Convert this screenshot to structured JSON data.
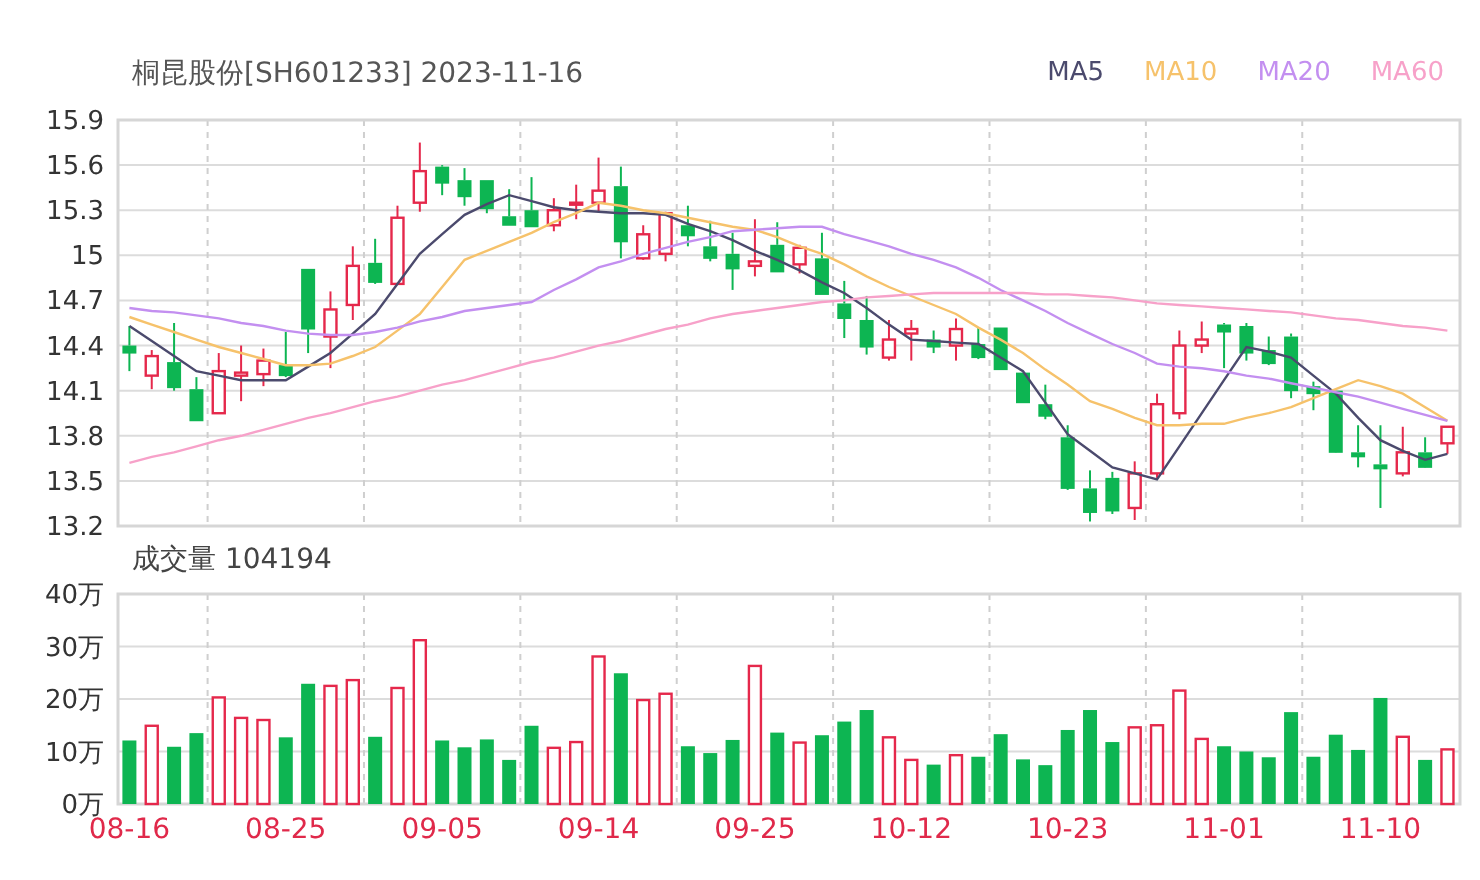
{
  "title": "桐昆股份[SH601233] 2023-11-16",
  "price_chart": {
    "chart_data": {
      "type": "candlestick",
      "grid": true,
      "ylim": [
        13.2,
        15.9
      ],
      "yticks": [
        13.2,
        13.5,
        13.8,
        14.1,
        14.4,
        14.7,
        15,
        15.3,
        15.6,
        15.9
      ],
      "ohlc": [
        [
          14.4,
          14.53,
          14.23,
          14.36
        ],
        [
          14.2,
          14.37,
          14.11,
          14.33
        ],
        [
          14.29,
          14.55,
          14.1,
          14.13
        ],
        [
          14.11,
          14.19,
          13.9,
          13.91
        ],
        [
          13.95,
          14.35,
          13.95,
          14.23
        ],
        [
          14.2,
          14.4,
          14.03,
          14.22
        ],
        [
          14.21,
          14.38,
          14.13,
          14.3
        ],
        [
          14.27,
          14.49,
          14.19,
          14.21
        ],
        [
          14.91,
          14.91,
          14.35,
          14.52
        ],
        [
          14.46,
          14.76,
          14.25,
          14.64
        ],
        [
          14.67,
          15.06,
          14.57,
          14.93
        ],
        [
          14.95,
          15.11,
          14.81,
          14.83
        ],
        [
          14.81,
          15.33,
          14.81,
          15.25
        ],
        [
          15.35,
          15.75,
          15.29,
          15.56
        ],
        [
          15.59,
          15.6,
          15.4,
          15.49
        ],
        [
          15.5,
          15.58,
          15.33,
          15.4
        ],
        [
          15.5,
          15.5,
          15.28,
          15.32
        ],
        [
          15.26,
          15.44,
          15.21,
          15.21
        ],
        [
          15.3,
          15.52,
          15.2,
          15.2
        ],
        [
          15.2,
          15.38,
          15.16,
          15.3
        ],
        [
          15.34,
          15.47,
          15.24,
          15.35
        ],
        [
          15.35,
          15.65,
          15.29,
          15.43
        ],
        [
          15.46,
          15.59,
          14.98,
          15.1
        ],
        [
          14.98,
          15.2,
          14.97,
          15.14
        ],
        [
          15.01,
          15.29,
          14.96,
          15.28
        ],
        [
          15.2,
          15.33,
          15.06,
          15.14
        ],
        [
          15.06,
          15.23,
          14.96,
          14.99
        ],
        [
          15.01,
          15.15,
          14.77,
          14.92
        ],
        [
          14.93,
          15.24,
          14.86,
          14.96
        ],
        [
          15.07,
          15.22,
          14.89,
          14.9
        ],
        [
          14.94,
          15.07,
          14.88,
          15.05
        ],
        [
          14.98,
          15.15,
          14.75,
          14.75
        ],
        [
          14.68,
          14.83,
          14.45,
          14.59
        ],
        [
          14.57,
          14.73,
          14.34,
          14.4
        ],
        [
          14.32,
          14.57,
          14.3,
          14.44
        ],
        [
          14.48,
          14.57,
          14.3,
          14.51
        ],
        [
          14.44,
          14.5,
          14.35,
          14.4
        ],
        [
          14.4,
          14.58,
          14.3,
          14.51
        ],
        [
          14.41,
          14.52,
          14.31,
          14.33
        ],
        [
          14.52,
          14.52,
          14.24,
          14.25
        ],
        [
          14.22,
          14.22,
          14.02,
          14.03
        ],
        [
          14.01,
          14.14,
          13.91,
          13.94
        ],
        [
          13.79,
          13.87,
          13.44,
          13.46
        ],
        [
          13.45,
          13.57,
          13.23,
          13.3
        ],
        [
          13.52,
          13.56,
          13.28,
          13.31
        ],
        [
          13.32,
          13.63,
          13.24,
          13.55
        ],
        [
          13.55,
          14.08,
          13.52,
          14.01
        ],
        [
          13.95,
          14.5,
          13.91,
          14.4
        ],
        [
          14.4,
          14.56,
          14.35,
          14.44
        ],
        [
          14.54,
          14.55,
          14.25,
          14.5
        ],
        [
          14.53,
          14.55,
          14.3,
          14.36
        ],
        [
          14.37,
          14.46,
          14.27,
          14.29
        ],
        [
          14.46,
          14.48,
          14.05,
          14.11
        ],
        [
          14.13,
          14.16,
          13.97,
          14.09
        ],
        [
          14.1,
          14.1,
          13.69,
          13.7
        ],
        [
          13.69,
          13.87,
          13.59,
          13.67
        ],
        [
          13.61,
          13.87,
          13.32,
          13.59
        ],
        [
          13.55,
          13.86,
          13.53,
          13.69
        ],
        [
          13.69,
          13.79,
          13.59,
          13.6
        ],
        [
          13.75,
          13.86,
          13.68,
          13.86
        ]
      ]
    }
  },
  "ma_chart": {
    "chart_data": {
      "type": "line",
      "ylim": [
        13.2,
        15.9
      ],
      "series": [
        {
          "name": "MA5",
          "color": "#4b4a6d",
          "values": [
            14.53,
            14.43,
            14.33,
            14.23,
            14.2,
            14.17,
            14.17,
            14.17,
            14.26,
            14.35,
            14.48,
            14.61,
            14.81,
            15.01,
            15.14,
            15.27,
            15.34,
            15.4,
            15.36,
            15.32,
            15.3,
            15.29,
            15.28,
            15.28,
            15.27,
            15.21,
            15.16,
            15.1,
            15.03,
            14.97,
            14.9,
            14.82,
            14.75,
            14.65,
            14.54,
            14.44,
            14.43,
            14.42,
            14.41,
            14.32,
            14.23,
            14.02,
            13.81,
            13.7,
            13.59,
            13.55,
            13.51,
            13.73,
            13.95,
            14.17,
            14.39,
            14.36,
            14.32,
            14.2,
            14.08,
            13.92,
            13.77,
            13.7,
            13.64,
            13.68
          ]
        },
        {
          "name": "MA10",
          "color": "#f6c26b",
          "values": [
            14.59,
            14.54,
            14.49,
            14.44,
            14.39,
            14.35,
            14.31,
            14.27,
            14.27,
            14.28,
            14.33,
            14.39,
            14.5,
            14.61,
            14.79,
            14.97,
            15.03,
            15.09,
            15.15,
            15.22,
            15.28,
            15.35,
            15.33,
            15.3,
            15.28,
            15.25,
            15.22,
            15.19,
            15.17,
            15.12,
            15.06,
            15.01,
            14.94,
            14.86,
            14.79,
            14.73,
            14.67,
            14.61,
            14.52,
            14.44,
            14.35,
            14.24,
            14.14,
            14.03,
            13.98,
            13.92,
            13.87,
            13.87,
            13.88,
            13.88,
            13.92,
            13.95,
            13.99,
            14.05,
            14.11,
            14.17,
            14.13,
            14.08,
            13.99,
            13.9
          ]
        },
        {
          "name": "MA20",
          "color": "#c38ff0",
          "values": [
            14.65,
            14.63,
            14.62,
            14.6,
            14.58,
            14.55,
            14.53,
            14.5,
            14.48,
            14.47,
            14.47,
            14.49,
            14.52,
            14.56,
            14.59,
            14.63,
            14.65,
            14.67,
            14.69,
            14.77,
            14.84,
            14.92,
            14.96,
            15.01,
            15.05,
            15.09,
            15.12,
            15.16,
            15.17,
            15.18,
            15.19,
            15.19,
            15.14,
            15.1,
            15.06,
            15.01,
            14.97,
            14.92,
            14.85,
            14.77,
            14.7,
            14.63,
            14.55,
            14.48,
            14.41,
            14.35,
            14.28,
            14.26,
            14.25,
            14.23,
            14.2,
            14.18,
            14.15,
            14.12,
            14.09,
            14.06,
            14.02,
            13.98,
            13.94,
            13.9
          ]
        },
        {
          "name": "MA60",
          "color": "#f7a1c9",
          "values": [
            13.62,
            13.66,
            13.69,
            13.73,
            13.77,
            13.8,
            13.84,
            13.88,
            13.92,
            13.95,
            13.99,
            14.03,
            14.06,
            14.1,
            14.14,
            14.17,
            14.21,
            14.25,
            14.29,
            14.32,
            14.36,
            14.4,
            14.43,
            14.47,
            14.51,
            14.54,
            14.58,
            14.61,
            14.63,
            14.65,
            14.67,
            14.69,
            14.7,
            14.72,
            14.73,
            14.74,
            14.75,
            14.75,
            14.75,
            14.75,
            14.75,
            14.74,
            14.74,
            14.73,
            14.72,
            14.7,
            14.68,
            14.67,
            14.66,
            14.65,
            14.64,
            14.63,
            14.62,
            14.6,
            14.58,
            14.57,
            14.55,
            14.53,
            14.52,
            14.5
          ]
        }
      ]
    }
  },
  "volume_title": "成交量 104194",
  "volume_chart": {
    "chart_data": {
      "type": "bar",
      "grid": true,
      "categories": [
        "08-16",
        null,
        null,
        null,
        null,
        null,
        null,
        "08-25",
        null,
        null,
        null,
        null,
        null,
        null,
        "09-05",
        null,
        null,
        null,
        null,
        null,
        null,
        "09-14",
        null,
        null,
        null,
        null,
        null,
        null,
        "09-25",
        null,
        null,
        null,
        null,
        null,
        null,
        "10-12",
        null,
        null,
        null,
        null,
        null,
        null,
        "10-23",
        null,
        null,
        null,
        null,
        null,
        null,
        "11-01",
        null,
        null,
        null,
        null,
        null,
        null,
        "11-10",
        null,
        null,
        null
      ],
      "ylim": [
        0,
        40
      ],
      "yticks": [
        {
          "value": 0,
          "label": "0万"
        },
        {
          "value": 10,
          "label": "10万"
        },
        {
          "value": 20,
          "label": "20万"
        },
        {
          "value": 30,
          "label": "30万"
        },
        {
          "value": 40,
          "label": "40万"
        }
      ],
      "values": [
        12.1,
        14.9,
        10.9,
        13.5,
        20.3,
        16.4,
        16.0,
        12.7,
        22.9,
        22.5,
        23.6,
        12.8,
        22.1,
        31.2,
        12.1,
        10.8,
        12.3,
        8.4,
        14.9,
        10.7,
        11.8,
        28.1,
        24.9,
        19.8,
        21.0,
        11.0,
        9.7,
        12.2,
        26.3,
        13.6,
        11.7,
        13.1,
        15.7,
        17.9,
        12.7,
        8.4,
        7.5,
        9.3,
        9.0,
        13.3,
        8.5,
        7.4,
        14.1,
        17.9,
        11.8,
        14.6,
        15.0,
        21.6,
        12.4,
        11.0,
        10.0,
        8.9,
        17.5,
        9.0,
        13.2,
        10.3,
        20.2,
        12.8,
        8.4,
        10.4
      ]
    }
  }
}
